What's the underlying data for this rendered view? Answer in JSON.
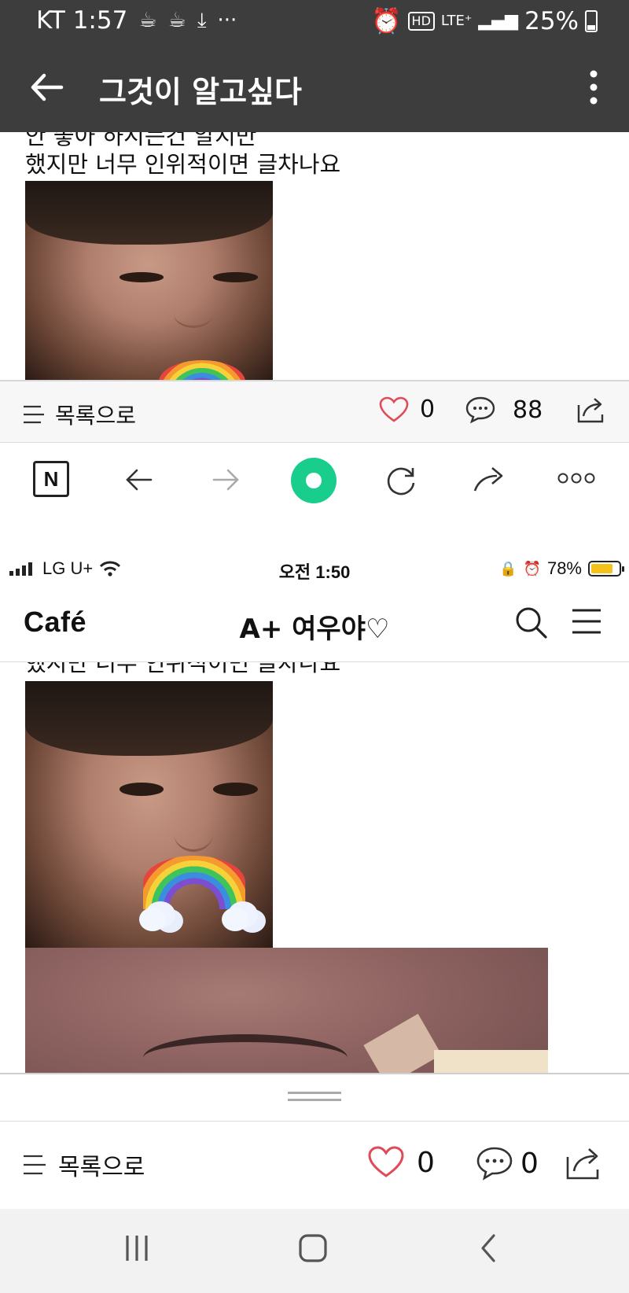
{
  "android": {
    "status": {
      "carrier_time": "KT 1:57",
      "dots": "···",
      "hd": "HD",
      "lte": "LTE⁺",
      "battery": "25%"
    },
    "appbar": {
      "title": "그것이 알고싶다"
    },
    "content": {
      "cut_line": "안 좋아 하시는건 알지만",
      "line": "했지만 너무 인위적이면 글차나요"
    },
    "footer": {
      "list_label": "목록으로",
      "likes": "0",
      "comments": "88"
    }
  },
  "ios": {
    "status": {
      "carrier": "LG U+",
      "time": "오전 1:50",
      "battery": "78%"
    },
    "header": {
      "logo": "Café",
      "title": "A+ 여우야♡"
    },
    "content": {
      "cut_line": "했지만 너무 인위적이면 글차나요"
    },
    "footer": {
      "list_label": "목록으로",
      "likes": "0",
      "comments": "0"
    }
  },
  "icons": [
    "back-arrow-icon",
    "more-vertical-icon",
    "list-icon",
    "heart-icon",
    "comment-icon",
    "share-icon",
    "naver-icon",
    "forward-icon",
    "refresh-icon",
    "search-icon",
    "menu-icon",
    "recent-apps-icon",
    "home-icon",
    "nav-back-icon"
  ],
  "colors": {
    "appbar": "#3d3d3d",
    "heart": "#e04b5a",
    "naver_green": "#19ce8c",
    "battery_yellow": "#f4c21b"
  }
}
